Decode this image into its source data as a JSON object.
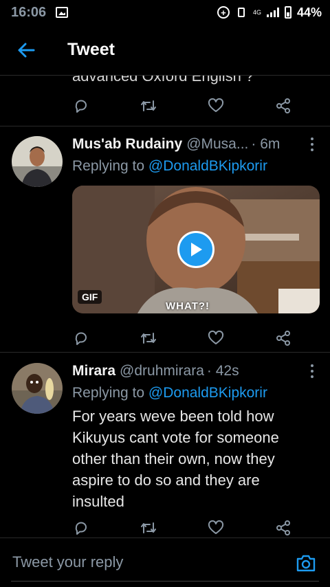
{
  "status_bar": {
    "time": "16:06",
    "network": "4G",
    "battery": "44%"
  },
  "header": {
    "title": "Tweet"
  },
  "previous_tweet": {
    "cut_text": "advanced Oxford English ?"
  },
  "tweets": [
    {
      "name": "Mus'ab Rudainy",
      "handle": "@Musa...",
      "time": "· 6m",
      "replying_prefix": "Replying to",
      "replying_to": "@DonaldBKipkorir",
      "media": {
        "badge": "GIF",
        "caption": "WHAT?!"
      }
    },
    {
      "name": "Mirara",
      "handle": "@druhmirara",
      "time": "· 42s",
      "replying_prefix": "Replying to",
      "replying_to": "@DonaldBKipkorir",
      "text": "For years weve been told how Kikuyus cant vote for someone other than their own, now they aspire to do so and they are insulted"
    }
  ],
  "reply_bar": {
    "placeholder": "Tweet your reply"
  },
  "colors": {
    "accent": "#1d9bf0",
    "background": "#000000",
    "secondary_text": "#8b98a5"
  }
}
